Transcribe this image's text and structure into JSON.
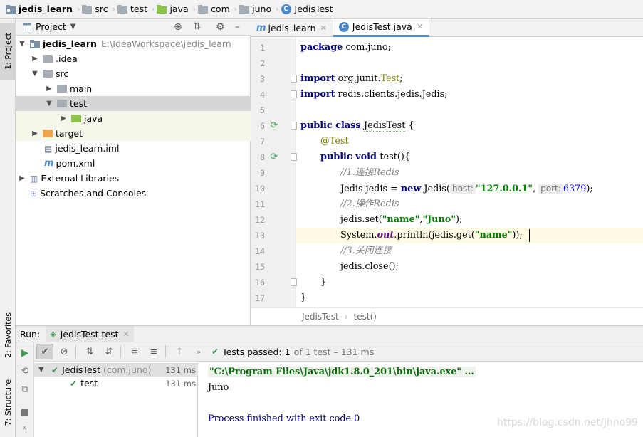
{
  "breadcrumb": {
    "items": [
      "jedis_learn",
      "src",
      "test",
      "java",
      "com",
      "juno",
      "JedisTest"
    ],
    "separator": "›"
  },
  "left_stripe": {
    "project": "1: Project",
    "favorites": "2: Favorites",
    "structure": "7: Structure"
  },
  "project_panel": {
    "title": "Project",
    "dropdown_icon": "chevron-down-icon",
    "tree": [
      {
        "label": "jedis_learn",
        "path": "E:\\IdeaWorkspace\\jedis_learn"
      },
      {
        "label": ".idea"
      },
      {
        "label": "src"
      },
      {
        "label": "main"
      },
      {
        "label": "test"
      },
      {
        "label": "java"
      },
      {
        "label": "target"
      },
      {
        "label": "jedis_learn.iml"
      },
      {
        "label": "pom.xml"
      },
      {
        "label": "External Libraries"
      },
      {
        "label": "Scratches and Consoles"
      }
    ]
  },
  "editor_tabs": [
    {
      "label": "jedis_learn",
      "active": false
    },
    {
      "label": "JedisTest.java",
      "active": true
    }
  ],
  "editor": {
    "line_numbers": [
      "1",
      "2",
      "3",
      "4",
      "5",
      "6",
      "7",
      "8",
      "9",
      "10",
      "11",
      "12",
      "13",
      "14",
      "15",
      "16",
      "17"
    ],
    "code": {
      "l1_kw": "package",
      "l1_rest": " com.juno;",
      "l3_kw": "import",
      "l3_rest": " org.junit.",
      "l3_cls": "Test",
      "l3_end": ";",
      "l4_kw": "import",
      "l4_rest": " redis.clients.jedis.Jedis;",
      "l6_kw": "public class ",
      "l6_name": "JedisTest",
      "l6_rest": " {",
      "l7_ann": "@Test",
      "l8_kw": "public void ",
      "l8_rest": "test(){",
      "l9_cmt": "//1.连接Redis",
      "l10_a": "Jedis jedis = ",
      "l10_kw": "new",
      "l10_b": " Jedis(",
      "l10_hint1": "host:",
      "l10_str": "\"127.0.0.1\"",
      "l10_c": ", ",
      "l10_hint2": "port:",
      "l10_num": "6379",
      "l10_d": ");",
      "l11_cmt": "//2.操作Redis",
      "l12_a": "jedis.set(",
      "l12_s1": "\"name\"",
      "l12_b": ",",
      "l12_s2": "\"Juno\"",
      "l12_c": ");",
      "l13_a": "System.",
      "l13_stat": "out",
      "l13_b": ".println(jedis.get(",
      "l13_s": "\"name\"",
      "l13_c": "));",
      "l14_cmt": "//3.关闭连接",
      "l15_a": "jedis.close();",
      "l16": "}",
      "l17": "}"
    }
  },
  "editor_breadcrumb": {
    "class_name": "JedisTest",
    "separator": "›",
    "method": "test()"
  },
  "run_panel": {
    "label": "Run:",
    "tab_label": "JedisTest.test",
    "status": "Tests passed:",
    "passed_count": "1",
    "detail": "of 1 test – 131 ms",
    "tree": [
      {
        "label": "JedisTest",
        "sub": "(com.juno)",
        "time": "131 ms"
      },
      {
        "label": "test",
        "time": "131 ms"
      }
    ],
    "console": [
      "\"C:\\Program Files\\Java\\jdk1.8.0_201\\bin\\java.exe\" ...",
      "Juno",
      "",
      "Process finished with exit code 0"
    ]
  },
  "watermark": "https://blog.csdn.net/Jhno99",
  "colors": {
    "accent": "#4a88c7",
    "success": "#3d9a50",
    "keyword": "#000080",
    "string": "#008000",
    "comment": "#808080",
    "annotation": "#808000"
  }
}
